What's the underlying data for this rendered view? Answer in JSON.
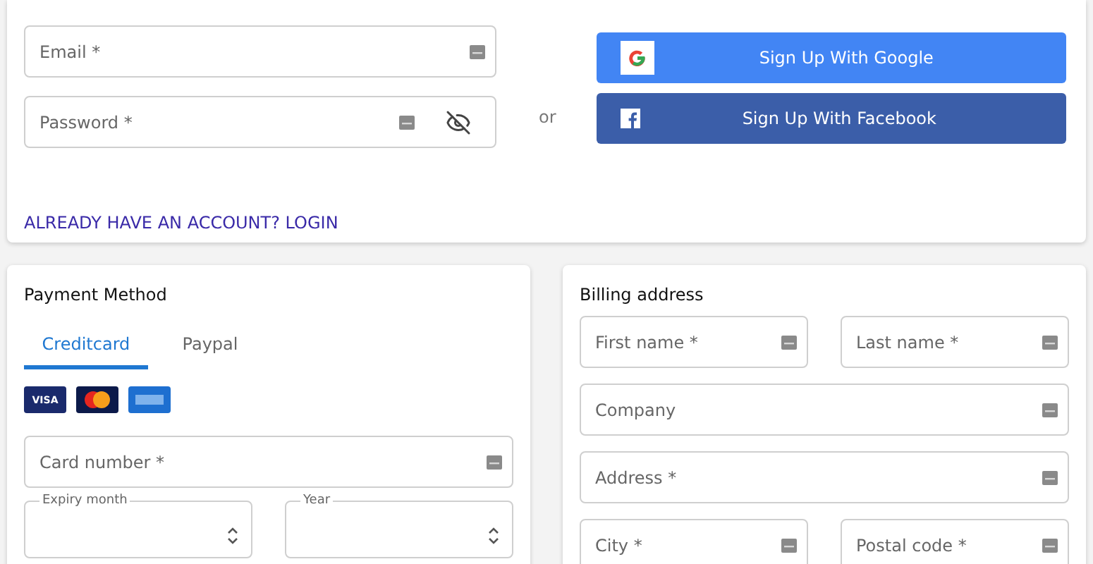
{
  "account": {
    "fields": [
      {
        "placeholder": "Email *",
        "kind": "text"
      },
      {
        "placeholder": "Password *",
        "kind": "password"
      }
    ],
    "separator": "or",
    "social_buttons": [
      {
        "kind": "google",
        "label": "Sign Up With Google"
      },
      {
        "kind": "facebook",
        "label": "Sign Up With Facebook"
      }
    ],
    "login_link": "ALREADY HAVE AN ACCOUNT? LOGIN"
  },
  "payment": {
    "title": "Payment Method",
    "tabs": [
      {
        "label": "Creditcard",
        "selected": true
      },
      {
        "label": "Paypal",
        "selected": false
      }
    ],
    "card_brands": [
      {
        "kind": "visa",
        "text": "VISA"
      },
      {
        "kind": "mastercard"
      },
      {
        "kind": "amex"
      }
    ],
    "card_number": {
      "placeholder": "Card number *"
    },
    "expiry": [
      {
        "label": "Expiry month"
      },
      {
        "label": "Year"
      }
    ]
  },
  "billing": {
    "title": "Billing address",
    "rows": [
      [
        {
          "placeholder": "First name *"
        },
        {
          "placeholder": "Last name *"
        }
      ],
      [
        {
          "placeholder": "Company"
        }
      ],
      [
        {
          "placeholder": "Address *"
        }
      ],
      [
        {
          "placeholder": "City *"
        },
        {
          "placeholder": "Postal code *"
        }
      ]
    ]
  }
}
